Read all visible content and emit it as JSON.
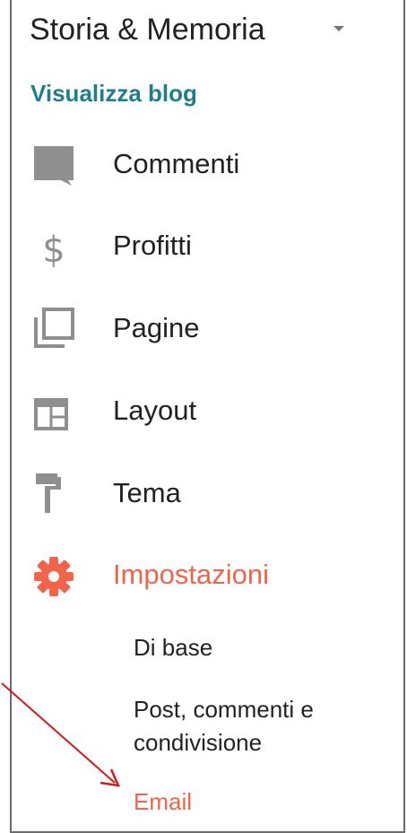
{
  "blog": {
    "title": "Storia & Memoria",
    "switcher_icon": "caret-down-icon",
    "view_label": "Visualizza blog"
  },
  "nav": {
    "items": [
      {
        "label": "Commenti",
        "icon": "comment-icon"
      },
      {
        "label": "Profitti",
        "icon": "dollar-icon"
      },
      {
        "label": "Pagine",
        "icon": "pages-icon"
      },
      {
        "label": "Layout",
        "icon": "layout-icon"
      },
      {
        "label": "Tema",
        "icon": "paint-roller-icon"
      },
      {
        "label": "Impostazioni",
        "icon": "gear-icon",
        "active": true
      }
    ],
    "settings_subitems": [
      {
        "label": "Di base"
      },
      {
        "label": "Post, commenti e"
      },
      {
        "label": "condivisione"
      },
      {
        "label": "Email",
        "active": true
      }
    ]
  },
  "colors": {
    "accent": "#f2634a",
    "link": "#1e7e8c",
    "icon_gray": "#8f8f8f",
    "annotation": "#d11a1a"
  }
}
